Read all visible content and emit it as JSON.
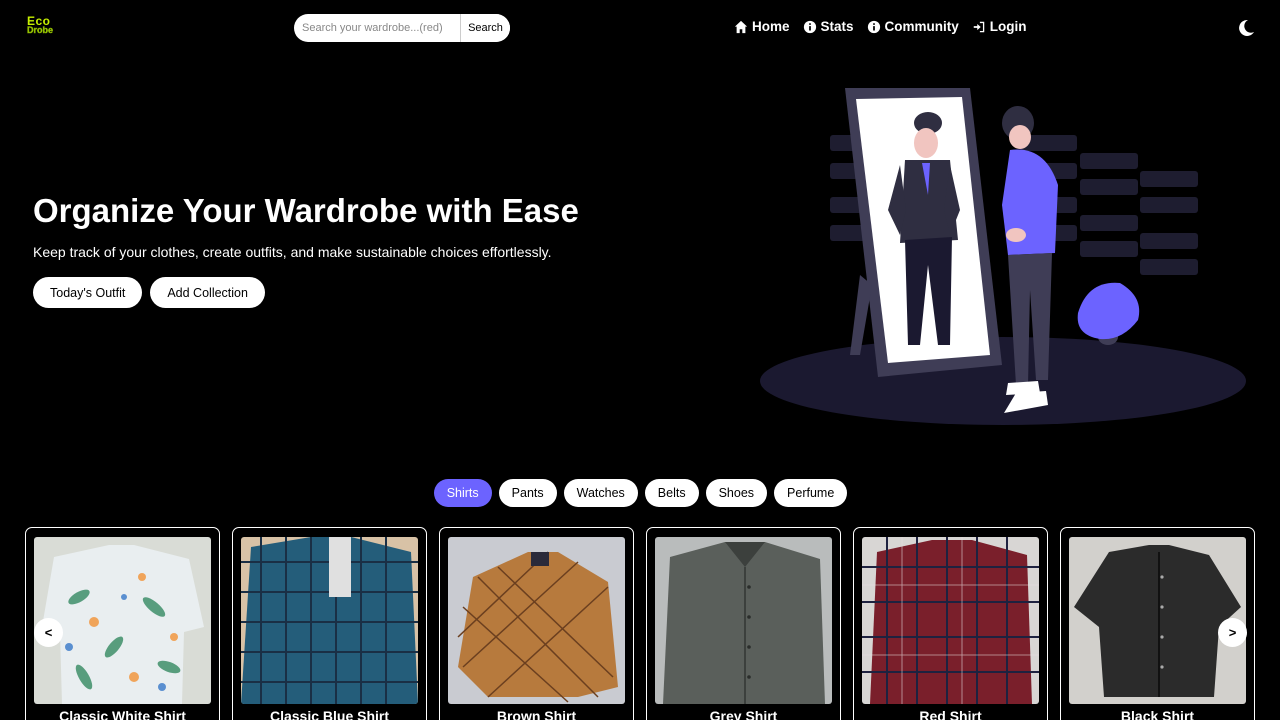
{
  "app": {
    "logo_line1": "Eco",
    "logo_line2": "Drobe"
  },
  "search": {
    "placeholder": "Search your wardrobe...(red)",
    "button_label": "Search"
  },
  "nav": {
    "home": "Home",
    "stats": "Stats",
    "community": "Community",
    "login": "Login"
  },
  "hero": {
    "title": "Organize Your Wardrobe with Ease",
    "subtitle": "Keep track of your clothes, create outfits, and make sustainable choices effortlessly.",
    "btn_outfit": "Today's Outfit",
    "btn_collection": "Add Collection"
  },
  "categories": [
    "Shirts",
    "Pants",
    "Watches",
    "Belts",
    "Shoes",
    "Perfume"
  ],
  "active_category": "Shirts",
  "carousel": {
    "prev": "<",
    "next": ">"
  },
  "items": [
    {
      "name": "Classic White Shirt"
    },
    {
      "name": "Classic Blue Shirt"
    },
    {
      "name": "Brown Shirt"
    },
    {
      "name": "Grey Shirt"
    },
    {
      "name": "Red Shirt"
    },
    {
      "name": "Black Shirt"
    }
  ],
  "colors": {
    "accent": "#6c63ff",
    "logo": "#c6f000",
    "background": "#000000"
  }
}
